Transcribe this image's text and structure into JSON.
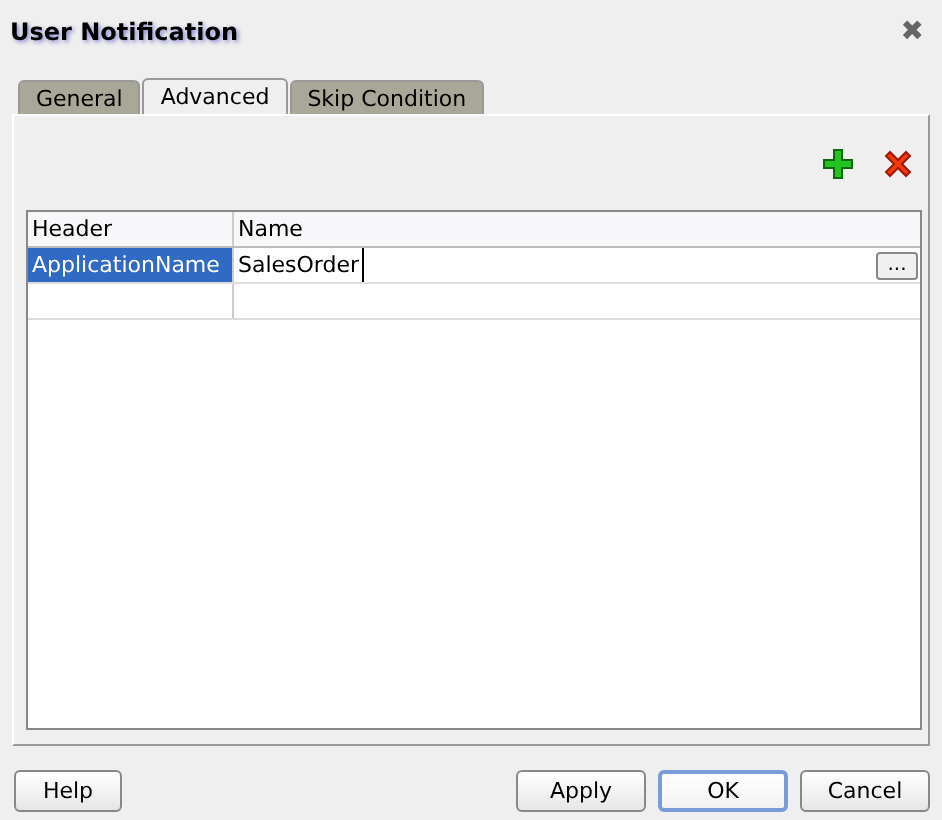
{
  "window": {
    "title": "User Notification",
    "close": "✖"
  },
  "tabs": [
    {
      "label": "General",
      "selected": false
    },
    {
      "label": "Advanced",
      "selected": true
    },
    {
      "label": "Skip Condition",
      "selected": false
    }
  ],
  "table": {
    "columns": [
      "Header",
      "Name"
    ],
    "rows": [
      {
        "header": "ApplicationName",
        "name": "SalesOrder",
        "selected": true,
        "browse": "..."
      }
    ]
  },
  "buttons": [
    {
      "label": "Help",
      "kind": "left",
      "default": false
    },
    {
      "label": "Apply",
      "kind": "right",
      "default": false
    },
    {
      "label": "OK",
      "kind": "right",
      "default": true
    },
    {
      "label": "Cancel",
      "kind": "right",
      "default": false
    }
  ]
}
